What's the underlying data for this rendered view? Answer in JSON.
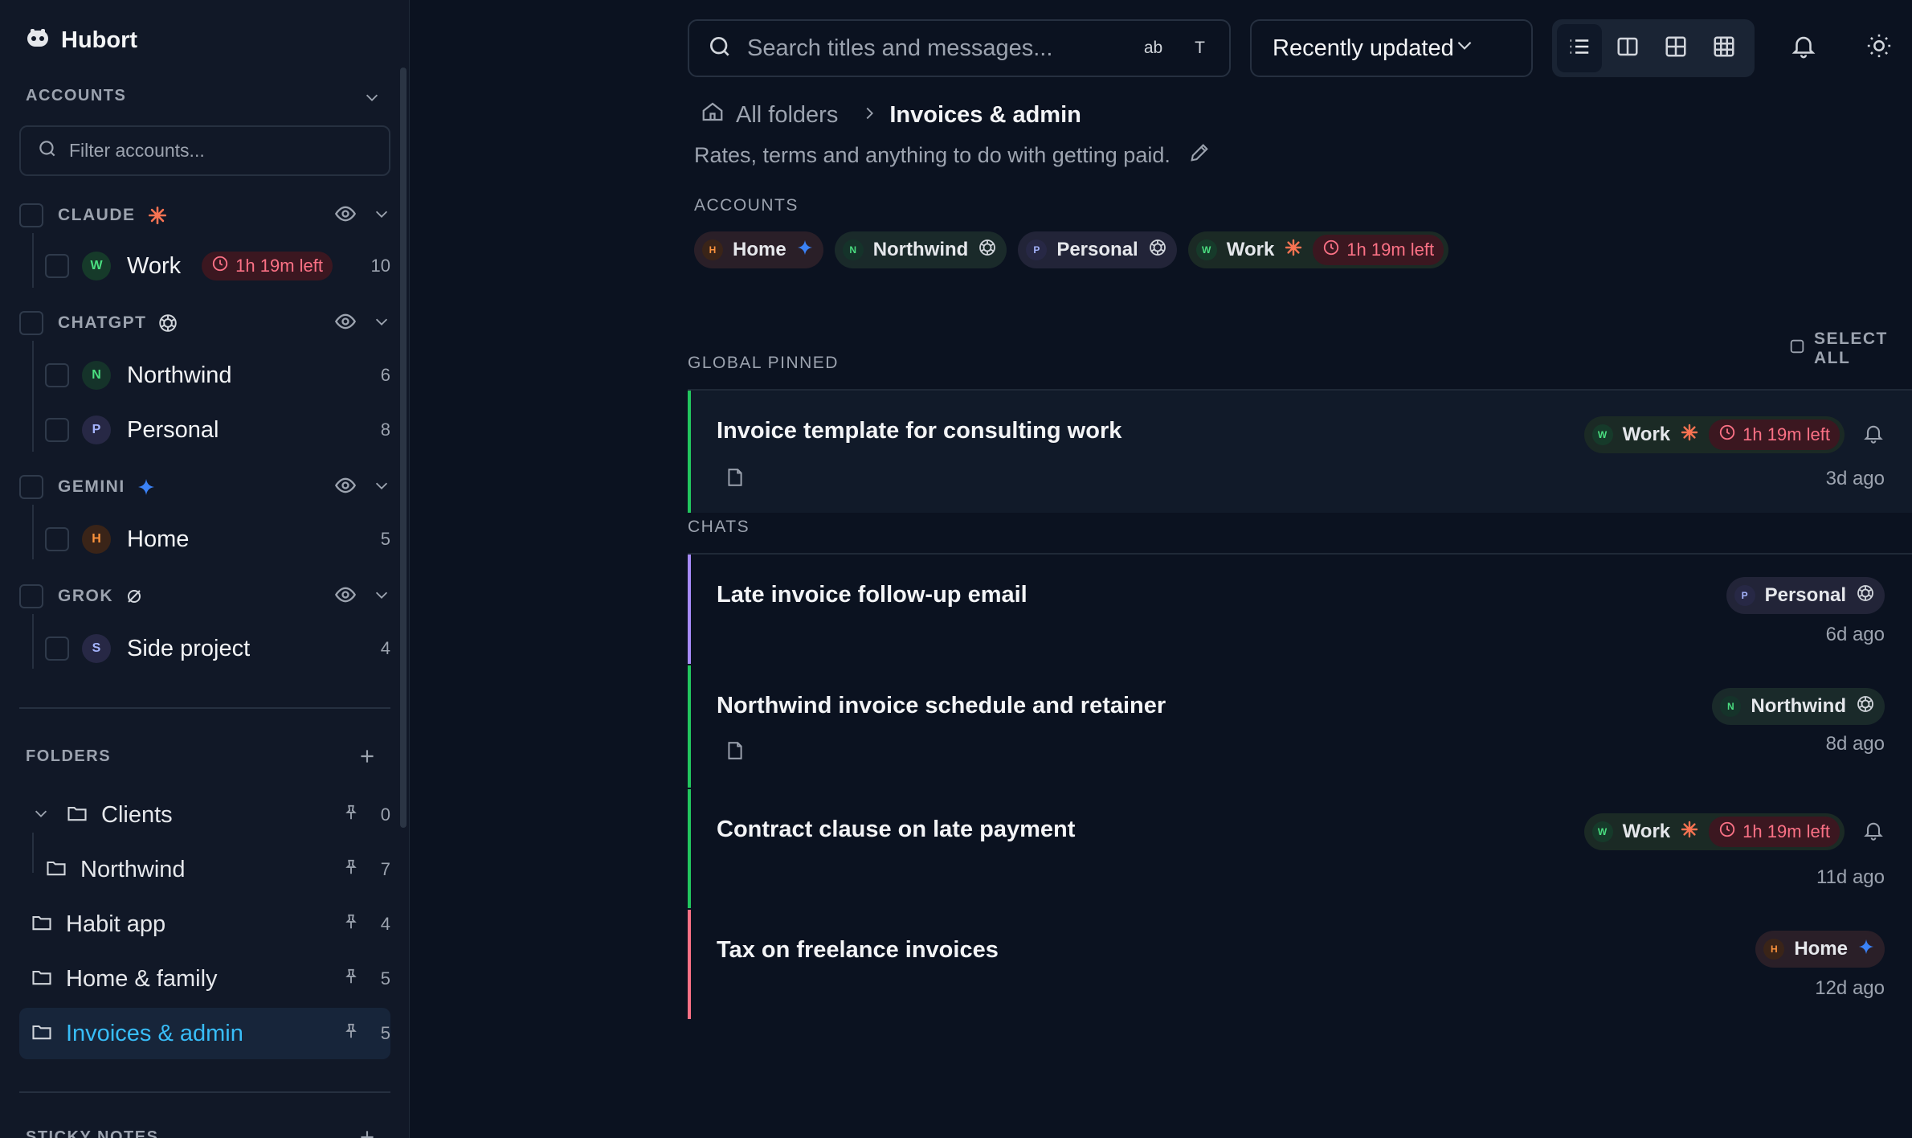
{
  "app": {
    "title": "Hubort"
  },
  "sidebar": {
    "accounts_header": "ACCOUNTS",
    "filter_placeholder": "Filter accounts...",
    "providers": [
      {
        "name": "CLAUDE",
        "accounts": [
          {
            "initial": "W",
            "name": "Work",
            "timer": "1h 19m left",
            "count": "10"
          }
        ]
      },
      {
        "name": "CHATGPT",
        "accounts": [
          {
            "initial": "N",
            "name": "Northwind",
            "count": "6"
          },
          {
            "initial": "P",
            "name": "Personal",
            "count": "8"
          }
        ]
      },
      {
        "name": "GEMINI",
        "accounts": [
          {
            "initial": "H",
            "name": "Home",
            "count": "5"
          }
        ]
      },
      {
        "name": "GROK",
        "accounts": [
          {
            "initial": "S",
            "name": "Side project",
            "count": "4"
          }
        ]
      }
    ],
    "folders_header": "FOLDERS",
    "folders": [
      {
        "name": "Clients",
        "count": "0"
      },
      {
        "name": "Northwind",
        "count": "7"
      },
      {
        "name": "Habit app",
        "count": "4"
      },
      {
        "name": "Home & family",
        "count": "5"
      },
      {
        "name": "Invoices & admin",
        "count": "5"
      }
    ],
    "sticky_header": "STICKY NOTES"
  },
  "toolbar": {
    "search_placeholder": "Search titles and messages...",
    "search_opt_case": "ab",
    "search_opt_title": "T",
    "sort_value": "Recently updated"
  },
  "breadcrumb": {
    "root": "All folders",
    "current": "Invoices & admin"
  },
  "folder": {
    "description": "Rates, terms and anything to do with getting paid.",
    "accounts_label": "ACCOUNTS",
    "chips": [
      {
        "initial": "H",
        "name": "Home"
      },
      {
        "initial": "N",
        "name": "Northwind"
      },
      {
        "initial": "P",
        "name": "Personal"
      },
      {
        "initial": "W",
        "name": "Work",
        "timer": "1h 19m left"
      }
    ]
  },
  "list": {
    "select_all": "SELECT ALL",
    "pinned_header": "GLOBAL PINNED",
    "chats_header": "CHATS",
    "pinned": [
      {
        "title": "Invoice template for consulting work",
        "account_initial": "W",
        "account": "Work",
        "timer": "1h 19m left",
        "time": "3d ago"
      }
    ],
    "chats": [
      {
        "title": "Late invoice follow-up email",
        "account_initial": "P",
        "account": "Personal",
        "time": "6d ago"
      },
      {
        "title": "Northwind invoice schedule and retainer",
        "account_initial": "N",
        "account": "Northwind",
        "time": "8d ago"
      },
      {
        "title": "Contract clause on late payment",
        "account_initial": "W",
        "account": "Work",
        "timer": "1h 19m left",
        "time": "11d ago"
      },
      {
        "title": "Tax on freelance invoices",
        "account_initial": "H",
        "account": "Home",
        "time": "12d ago"
      }
    ]
  },
  "colors": {
    "claude": "#f97352",
    "gemini": "#3b82f6",
    "accent": "#38bdf8",
    "timer": "#fb7185",
    "work": "#22c55e",
    "personal": "#a78bfa",
    "northwind": "#22c55e",
    "home": "#fb7185"
  }
}
